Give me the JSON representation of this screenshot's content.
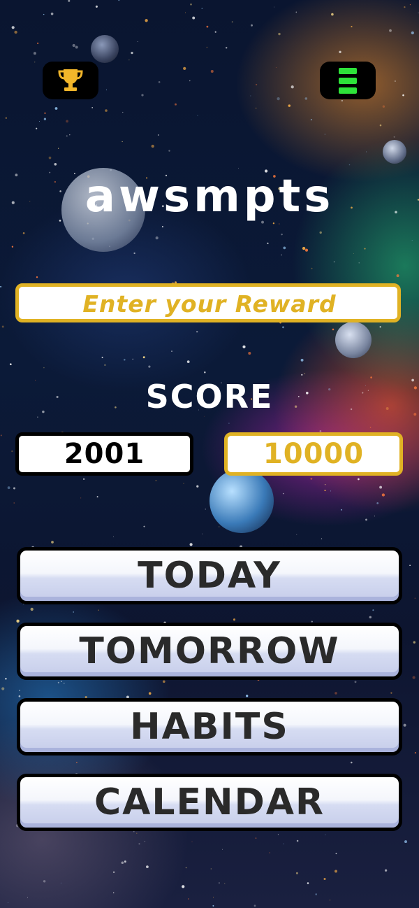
{
  "app": {
    "title": "awsmpts"
  },
  "header": {
    "trophy_icon": "trophy-icon",
    "menu_icon": "menu-icon",
    "menu_color": "#2ee23a"
  },
  "reward": {
    "placeholder": "Enter your Reward",
    "accent": "#e0b224"
  },
  "score": {
    "label": "SCORE",
    "current": "2001",
    "goal": "10000"
  },
  "nav": {
    "today": "TODAY",
    "tomorrow": "TOMORROW",
    "habits": "HABITS",
    "calendar": "CALENDAR"
  }
}
